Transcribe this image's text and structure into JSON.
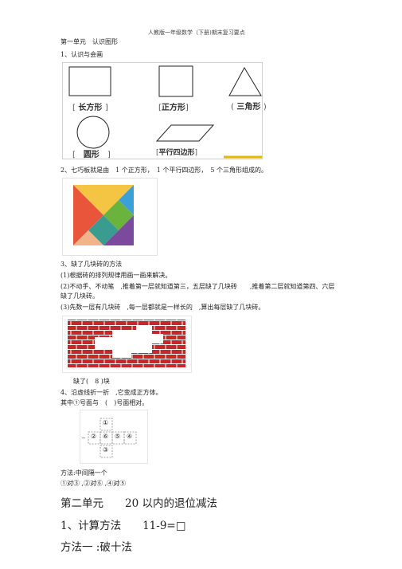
{
  "header": {
    "title": "人教版一年级数学（下册)期末复习要点"
  },
  "unit1": {
    "title": "第一单元　认识图形",
    "s1": {
      "title": "1、认识与会画"
    },
    "shapes": {
      "rectangle": "长方形",
      "square": "正方形",
      "triangle": "三角形",
      "circle": "圆形",
      "parallelogram": "平行四边形"
    },
    "s2": {
      "text": "2、七巧板就是由　1 个正方形，　1 个平行四边形，　5 个三角形组成的。"
    },
    "s3": {
      "title": "3、缺了几块砖的方法",
      "l1": "(1)根据砖的排列规律用画一画来解决。",
      "l2a": "(2)不动手、不动笔　,推着第一层就知道第三，五层缺了几块砖　　,推着第二层就知道第四、六层",
      "l2b": "缺了几块砖。",
      "l3": "(3)先数一层有几块砖　,每一层都就是一样长的　,算出每层缺了几块砖。",
      "answer": "缺了(　8 )块"
    },
    "s4": {
      "l1": "4、沿虚线折一折　,它变成正方体。",
      "l2": "其中①号面与　(　)号面相对。",
      "net": [
        "①",
        "②",
        "③",
        "④",
        "⑤",
        "⑥"
      ],
      "method": "方法:中间隔一个",
      "pairs": "①对③ ,②对⑥ ,④对⑤"
    }
  },
  "unit2": {
    "title": "第二单元　　20 以内的退位减法",
    "s1": "1、计算方法　　11-9=□",
    "m1": "方法一 :破十法"
  }
}
